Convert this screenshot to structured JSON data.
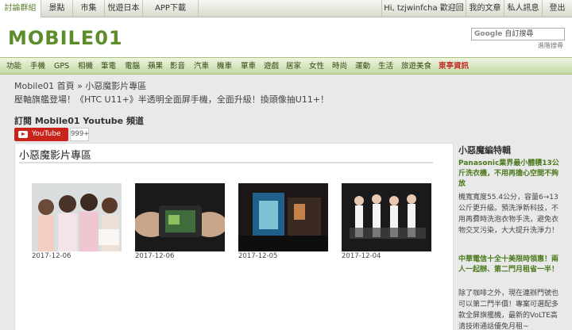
{
  "topbar": {
    "tabs": [
      "討論群組",
      "景點",
      "市集",
      "悅遊日本",
      "APP下載"
    ],
    "greeting": "Hi, tzjwinfcha 歡迎回來 ▼",
    "links": [
      "我的文章",
      "私人訊息",
      "登出"
    ]
  },
  "header": {
    "logo": "MOBILE01",
    "search_placeholder": "自訂搜尋",
    "search_brand": "Google",
    "advanced_search": "進階搜尋"
  },
  "nav": {
    "items": [
      "功能",
      "手機",
      "GPS",
      "相機",
      "筆電",
      "電腦",
      "蘋果",
      "影音",
      "汽車",
      "機車",
      "單車",
      "遊戲",
      "居家",
      "女性",
      "時尚",
      "運動",
      "生活",
      "旅遊美食"
    ],
    "hot": "東亭資訊"
  },
  "content": {
    "breadcrumb": "Mobile01 首頁 » 小惡魔影片專區",
    "promo": "壓軸旗艦登場！《HTC U11+》半透明全面屏手機，全面升級！換頭像抽U11+！",
    "youtube_title": "訂閱 Mobile01 Youtube 頻道",
    "youtube_label": "YouTube",
    "youtube_count": "999+",
    "section_title": "小惡魔影片專區",
    "videos": [
      {
        "date": "2017-12-06"
      },
      {
        "date": "2017-12-06"
      },
      {
        "date": "2017-12-05"
      },
      {
        "date": "2017-12-04"
      }
    ]
  },
  "sidebar": {
    "title": "小惡魔編特輯",
    "articles": [
      {
        "headline": "Panasonic業界最小體積13公斤洗衣機，不用再擔心空間不夠放",
        "body": "機寬寬度55.4公分，容量6→13公斤更升級。預洗淨新科技，不用再費時洗泡衣物手洗，避免衣物交叉污染，大大提升洗淨力！"
      },
      {
        "headline": "中華電信十全十美限時領惠！兩人一起辦、第二門月租省一半！",
        "body": "除了咖啡之外，現在連辦門號也可以第二門半價！專案可選配多款全屏旗艦機，最新的VoLTE高清技術通話優免月租~"
      }
    ]
  },
  "colors": {
    "accent": "#5d8d2a",
    "youtube": "#c8241c",
    "hot": "#c0302a"
  }
}
